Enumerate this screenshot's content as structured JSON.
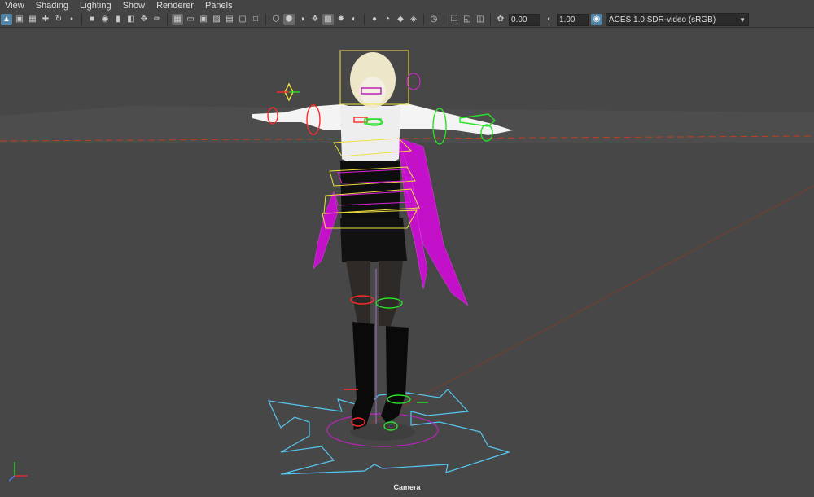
{
  "menubar": {
    "items": [
      "View",
      "Shading",
      "Lighting",
      "Show",
      "Renderer",
      "Panels"
    ]
  },
  "toolbar": {
    "exposure_value": "0.00",
    "gamma_value": "1.00",
    "color_space": "ACES 1.0 SDR-video (sRGB)"
  },
  "viewport": {
    "camera_label": "Camera"
  },
  "colors": {
    "background": "#474747",
    "ui": "#444444",
    "selection": "#5285a6",
    "rig_red": "#ff2a2a",
    "rig_green": "#2adf2a",
    "rig_yellow": "#f0e040",
    "rig_cyan": "#55c8f0",
    "rig_magenta": "#cc11cc",
    "hair": "#ede6c8"
  },
  "icons": [
    "select-icon",
    "lasso-icon",
    "paint-select-icon",
    "move-icon",
    "rotate-icon",
    "scale-icon",
    "camera-icon",
    "camera-attributes-icon",
    "bookmark-icon",
    "image-plane-icon",
    "pan-zoom-icon",
    "grease-pencil-icon",
    "grid-icon",
    "film-gate-icon",
    "resolution-gate-icon",
    "gate-mask-icon",
    "field-chart-icon",
    "safe-action-icon",
    "safe-title-icon",
    "wireframe-icon",
    "smooth-shade-icon",
    "default-material-icon",
    "wireframe-on-shaded-icon",
    "textured-icon",
    "lights-icon",
    "shadows-icon",
    "ambient-occlusion-icon",
    "motion-blur-icon",
    "anti-alias-icon",
    "depth-of-field-icon",
    "isolate-select-icon",
    "xray-icon",
    "xray-joints-icon",
    "xray-components-icon",
    "exposure-icon",
    "gamma-icon",
    "color-management-icon"
  ]
}
